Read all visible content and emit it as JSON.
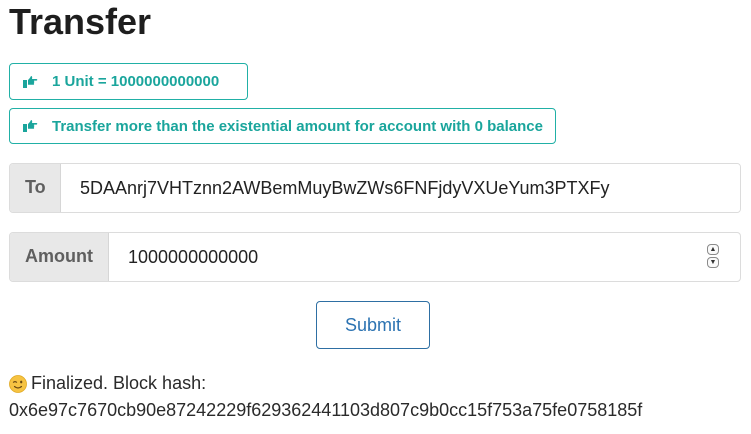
{
  "page": {
    "title": "Transfer"
  },
  "notices": [
    {
      "text": "1 Unit = 1000000000000",
      "icon": "pointing-hand-icon"
    },
    {
      "text": "Transfer more than the existential amount for account with 0 balance",
      "icon": "pointing-hand-icon"
    }
  ],
  "form": {
    "to": {
      "label": "To",
      "value": "5DAAnrj7VHTznn2AWBemMuyBwZWs6FNFjdyVXUeYum3PTXFy"
    },
    "amount": {
      "label": "Amount",
      "value": "1000000000000"
    },
    "submit_label": "Submit"
  },
  "status": {
    "icon": "wink-emoji-icon",
    "label": "Finalized. Block hash:",
    "hash": "0x6e97c7670cb90e87242229f629362441103d807c9b0cc15f753a75fe0758185f"
  },
  "colors": {
    "accent": "#21b0a6",
    "button_border": "#2e6fa3",
    "label_bg": "#e8e8e8"
  }
}
